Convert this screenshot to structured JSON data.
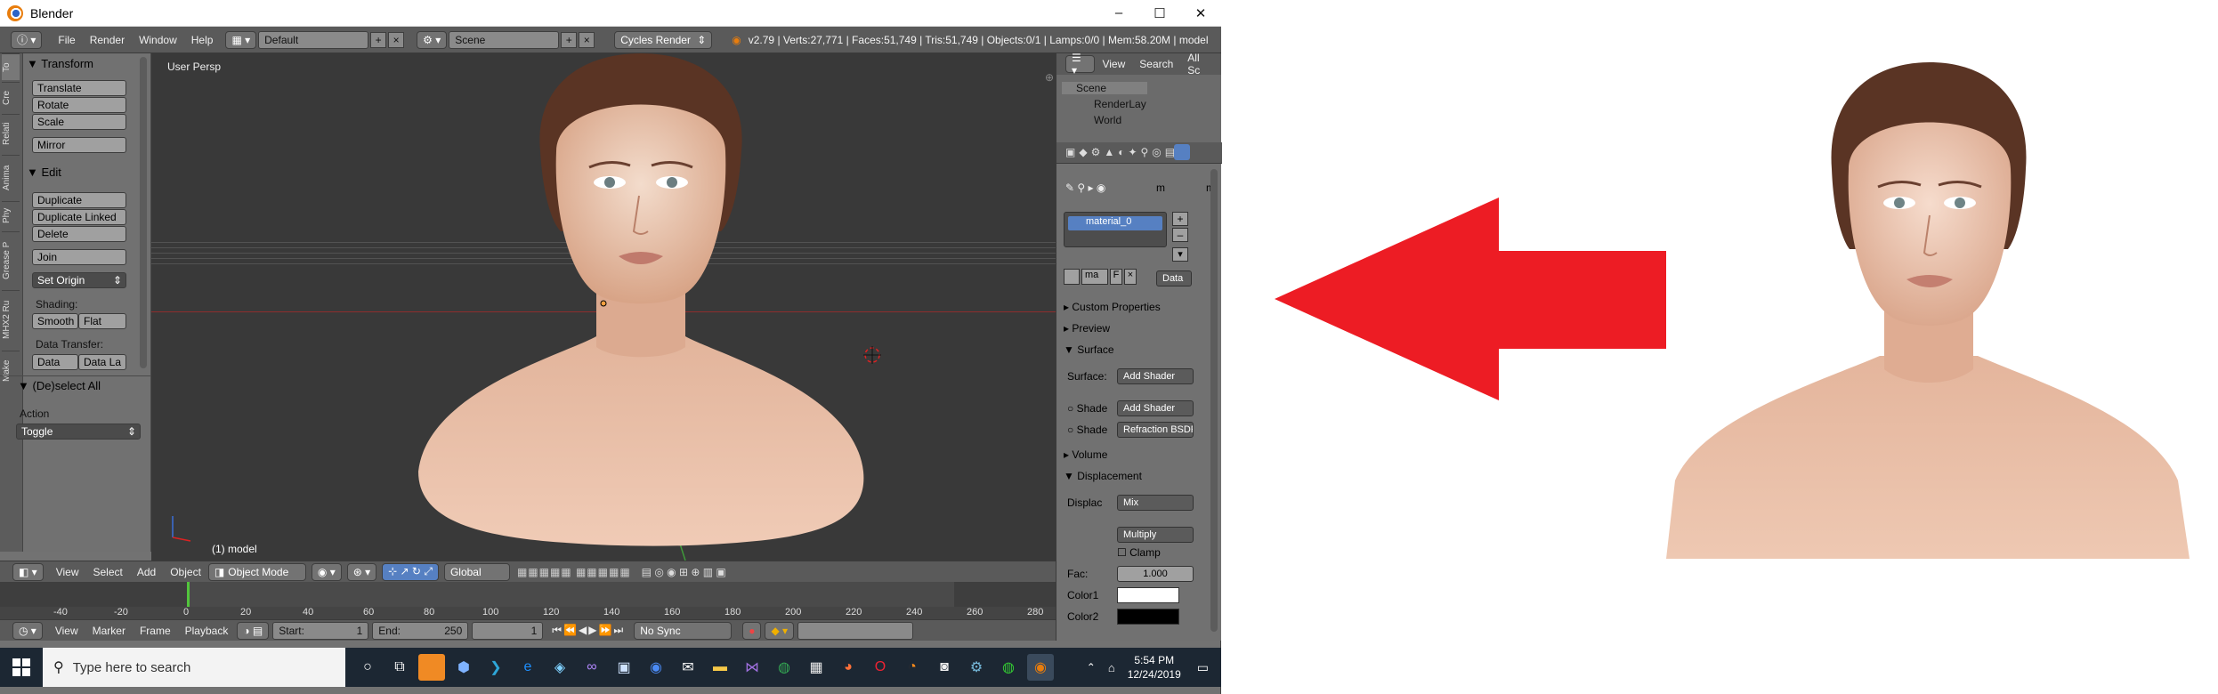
{
  "window": {
    "title": "Blender",
    "controls": [
      "–",
      "☐",
      "✕"
    ]
  },
  "infobar": {
    "menus": [
      "File",
      "Render",
      "Window",
      "Help"
    ],
    "layout": "Default",
    "scene": "Scene",
    "engine": "Cycles Render",
    "stats": "v2.79 | Verts:27,771 | Faces:51,749 | Tris:51,749 | Objects:0/1 | Lamps:0/0 | Mem:58.20M | model"
  },
  "vertical_tabs": [
    "To",
    "Cre",
    "Relati",
    "Anima",
    "Phy",
    "Grease P",
    "MHX2 Ru",
    "Make"
  ],
  "toolshelf": {
    "transform_header": "Transform",
    "transform_buttons": [
      "Translate",
      "Rotate",
      "Scale",
      "Mirror"
    ],
    "edit_header": "Edit",
    "edit_buttons": [
      "Duplicate",
      "Duplicate Linked",
      "Delete",
      "Join"
    ],
    "set_origin": "Set Origin",
    "shading_label": "Shading:",
    "smooth": "Smooth",
    "flat": "Flat",
    "data_transfer_label": "Data Transfer:",
    "data": "Data",
    "data_la": "Data La",
    "deselect_header": "(De)select All",
    "action_label": "Action",
    "action_value": "Toggle"
  },
  "viewport": {
    "label": "User Persp",
    "object": "(1) model"
  },
  "viewport_header": {
    "menus": [
      "View",
      "Select",
      "Add",
      "Object"
    ],
    "mode": "Object Mode",
    "orientation": "Global"
  },
  "timeline": {
    "ticks": [
      "-40",
      "-20",
      "0",
      "20",
      "40",
      "60",
      "80",
      "100",
      "120",
      "140",
      "160",
      "180",
      "200",
      "220",
      "240",
      "260",
      "280"
    ],
    "menus": [
      "View",
      "Marker",
      "Frame",
      "Playback"
    ],
    "start_label": "Start:",
    "start_value": "1",
    "end_label": "End:",
    "end_value": "250",
    "current": "1",
    "sync": "No Sync"
  },
  "outliner": {
    "menus": [
      "View",
      "Search",
      "All Sc"
    ],
    "items": [
      "Scene",
      "RenderLay",
      "World"
    ]
  },
  "properties": {
    "material_slot": "material_0",
    "material_short": "ma",
    "f_label": "F",
    "data_toggle": "Data",
    "m_label": "m",
    "sections": {
      "custom_props": "Custom Properties",
      "preview": "Preview",
      "surface": "Surface",
      "volume": "Volume",
      "displacement": "Displacement"
    },
    "surface_label": "Surface:",
    "surface_value": "Add Shader",
    "shade1_label": "Shade",
    "shade1_value": "Add Shader",
    "shade2_label": "Shade",
    "shade2_value": "Refraction BSDF",
    "displac_label": "Displac",
    "displac_value": "Mix",
    "multiply": "Multiply",
    "clamp": "Clamp",
    "fac_label": "Fac:",
    "fac_value": "1.000",
    "color1_label": "Color1",
    "color2_label": "Color2"
  },
  "taskbar": {
    "search_placeholder": "Type here to search",
    "time": "5:54 PM",
    "date": "12/24/2019"
  },
  "colors": {
    "arrow": "#ed1c24",
    "skin": "#e8b79c",
    "hair": "#5a3424",
    "selection": "#5680c2"
  }
}
